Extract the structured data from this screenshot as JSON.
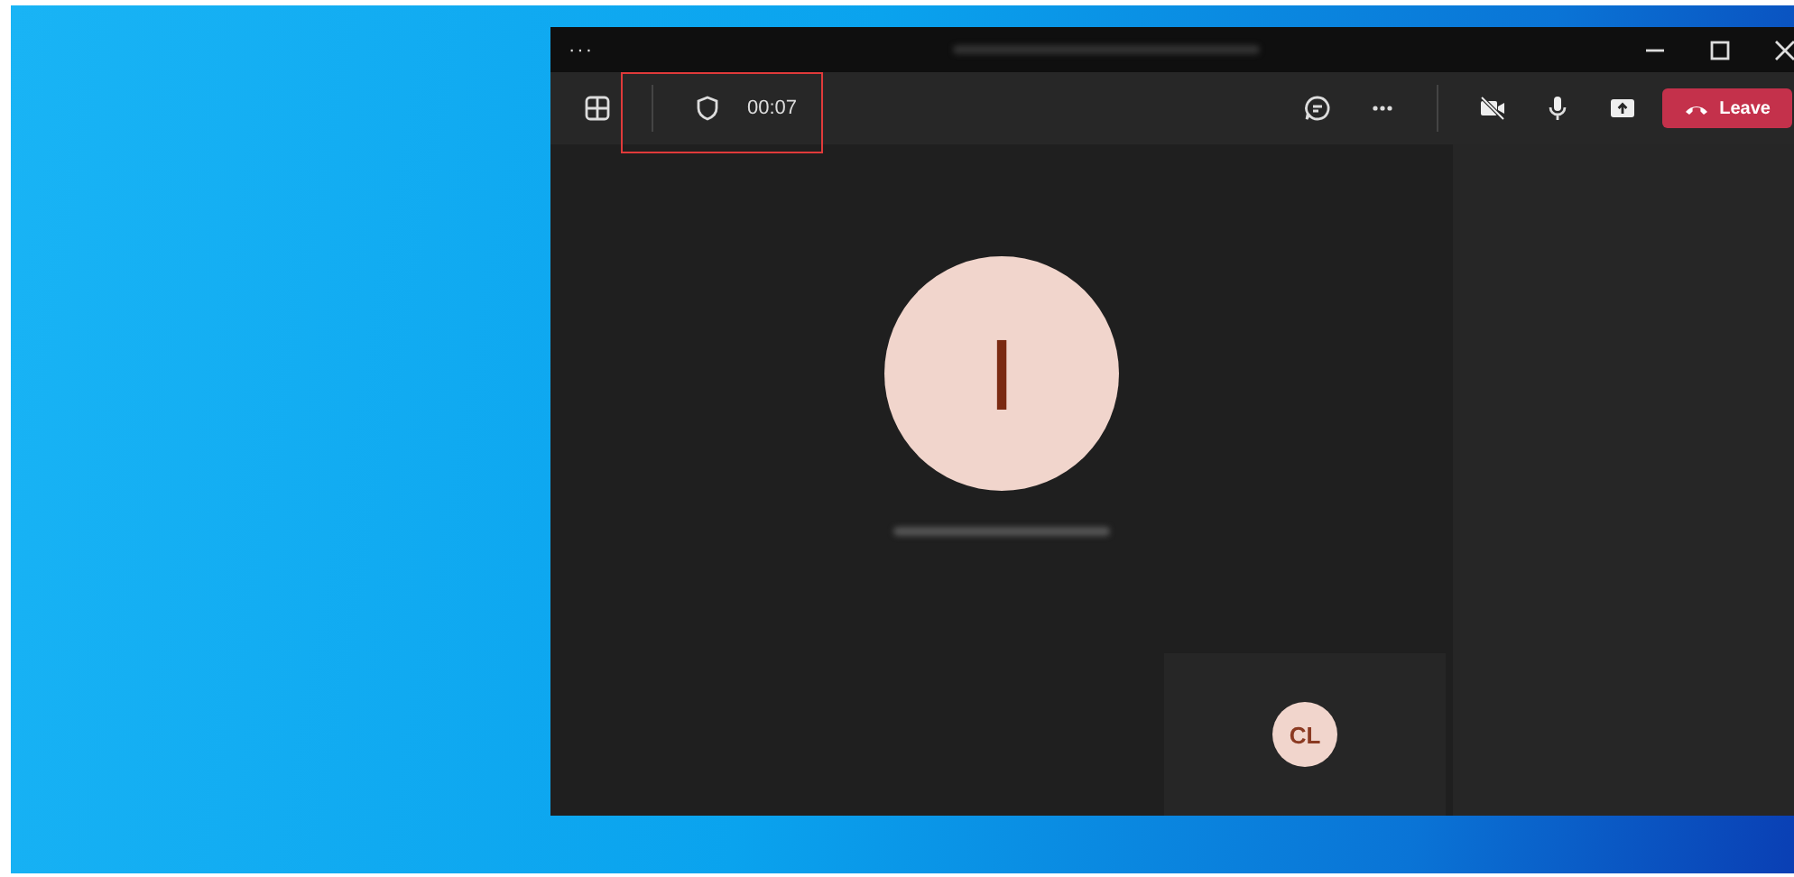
{
  "window": {
    "title_menu": "···"
  },
  "toolbar": {
    "timer": "00:07",
    "leave_button": "Leave"
  },
  "main_participant": {
    "initial": "I"
  },
  "self_view": {
    "initials": "CL"
  }
}
